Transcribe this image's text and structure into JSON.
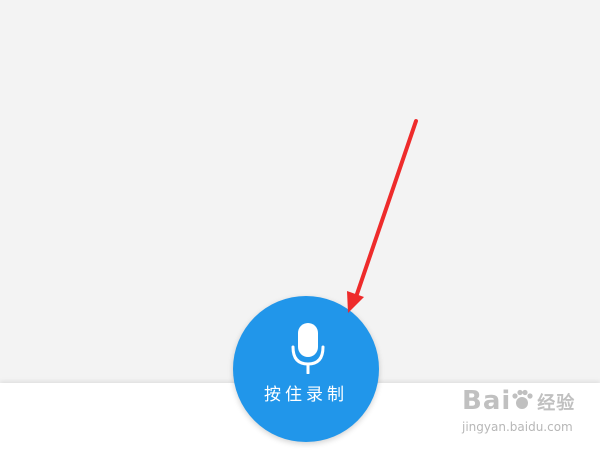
{
  "record_button": {
    "label": "按住录制",
    "icon": "microphone-icon",
    "color": "#2196ea"
  },
  "annotation": {
    "color": "#ee2b2b"
  },
  "watermark": {
    "brand": "Bai",
    "brand_suffix": "经验",
    "url": "jingyan.baidu.com"
  }
}
